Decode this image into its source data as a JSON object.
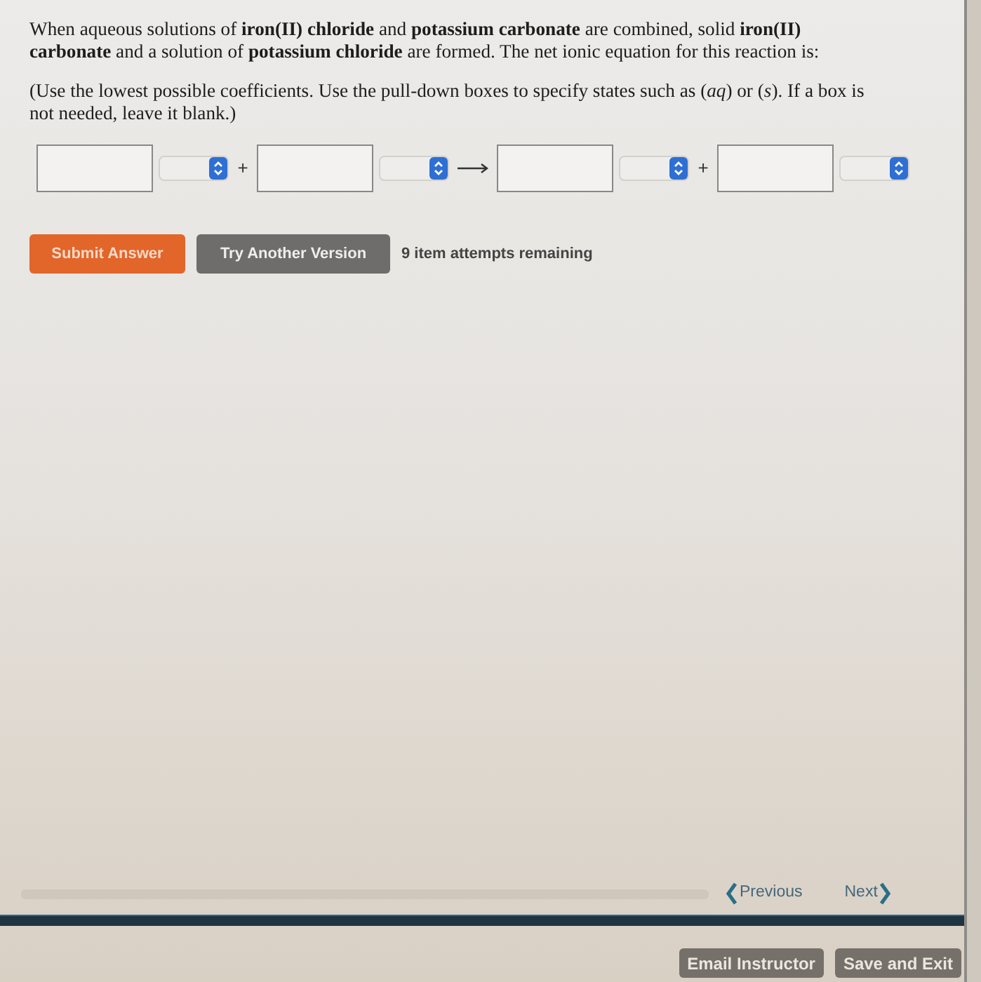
{
  "question": "When aqueous solutions of **iron(II) chloride** and **potassium carbonate** are combined, solid **iron(II) carbonate** and a solution of **potassium chloride** are formed. The net ionic equation for this reaction is:",
  "instructions": "(Use the lowest possible coefficients. Use the pull-down boxes to specify states such as (*aq*) or (*s*). If a box is not needed, leave it blank.)",
  "equation": [
    {
      "kind": "species"
    },
    {
      "kind": "plus",
      "text": "+"
    },
    {
      "kind": "species"
    },
    {
      "kind": "arrow"
    },
    {
      "kind": "species"
    },
    {
      "kind": "plus",
      "text": "+"
    },
    {
      "kind": "species"
    }
  ],
  "actions": [
    {
      "kind": "primary",
      "label": "Submit Answer"
    },
    {
      "kind": "secondary",
      "label": "Try Another Version"
    }
  ],
  "attempts": "9 item attempts remaining",
  "navigation": {
    "previous": "Previous",
    "next": "Next"
  },
  "footer_buttons": [
    "Email Instructor",
    "Save and Exit"
  ]
}
